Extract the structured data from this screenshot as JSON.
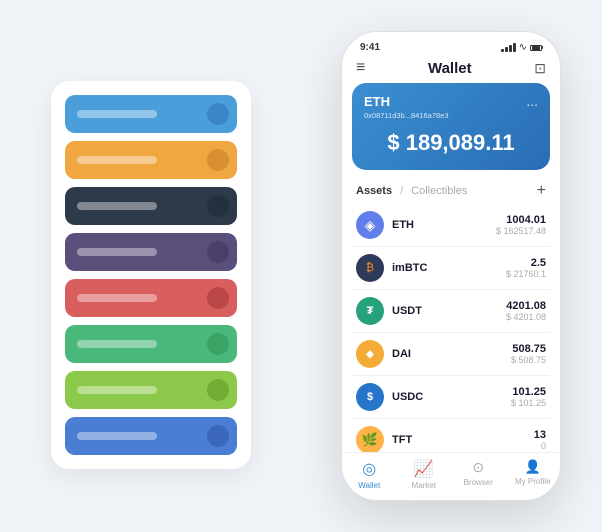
{
  "scene": {
    "background_color": "#f0f4f8"
  },
  "card_stack": {
    "items": [
      {
        "color": "card-blue",
        "label": "card-1"
      },
      {
        "color": "card-orange",
        "label": "card-2"
      },
      {
        "color": "card-dark",
        "label": "card-3"
      },
      {
        "color": "card-purple",
        "label": "card-4"
      },
      {
        "color": "card-red",
        "label": "card-5"
      },
      {
        "color": "card-green",
        "label": "card-6"
      },
      {
        "color": "card-lightgreen",
        "label": "card-7"
      },
      {
        "color": "card-lightblue",
        "label": "card-8"
      }
    ]
  },
  "phone": {
    "status_bar": {
      "time": "9:41",
      "wifi": "wifi",
      "battery": "battery"
    },
    "header": {
      "menu_icon": "≡",
      "title": "Wallet",
      "scan_icon": "⊡"
    },
    "eth_card": {
      "name": "ETH",
      "address": "0x08711d3b...8416a78e3",
      "more_icon": "...",
      "balance": "$ 189,089.11",
      "dollar_sign": "$"
    },
    "assets_section": {
      "tab_assets": "Assets",
      "tab_divider": "/",
      "tab_collectibles": "Collectibles",
      "add_icon": "+"
    },
    "assets": [
      {
        "symbol": "ETH",
        "icon_char": "◈",
        "icon_class": "icon-eth",
        "amount": "1004.01",
        "usd": "$ 162517.48"
      },
      {
        "symbol": "imBTC",
        "icon_char": "₿",
        "icon_class": "icon-imbtc",
        "amount": "2.5",
        "usd": "$ 21760.1"
      },
      {
        "symbol": "USDT",
        "icon_char": "₮",
        "icon_class": "icon-usdt",
        "amount": "4201.08",
        "usd": "$ 4201.08"
      },
      {
        "symbol": "DAI",
        "icon_char": "◈",
        "icon_class": "icon-dai",
        "amount": "508.75",
        "usd": "$ 508.75"
      },
      {
        "symbol": "USDC",
        "icon_char": "$",
        "icon_class": "icon-usdc",
        "amount": "101.25",
        "usd": "$ 101.25"
      },
      {
        "symbol": "TFT",
        "icon_char": "🌿",
        "icon_class": "icon-tft",
        "amount": "13",
        "usd": "0"
      }
    ],
    "bottom_nav": [
      {
        "label": "Wallet",
        "icon": "◎",
        "active": true
      },
      {
        "label": "Market",
        "icon": "↗",
        "active": false
      },
      {
        "label": "Browser",
        "icon": "⊙",
        "active": false
      },
      {
        "label": "My Profile",
        "icon": "👤",
        "active": false
      }
    ]
  }
}
